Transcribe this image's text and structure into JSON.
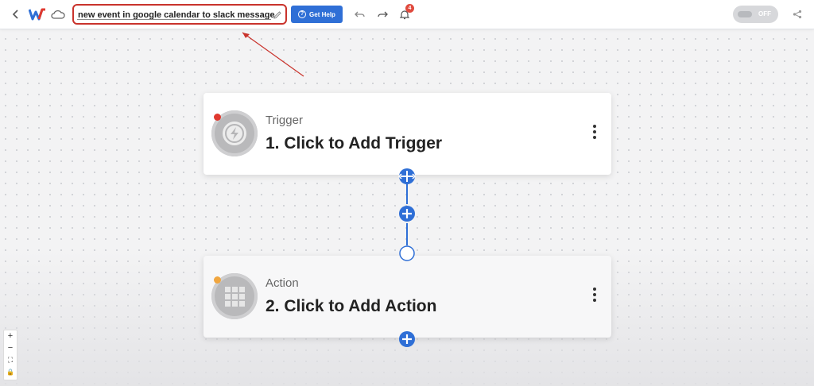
{
  "header": {
    "workflow_name": "new event in google calendar to slack message",
    "help_label": "Get Help",
    "help_icon": "question-circle-icon",
    "notification_count": "4",
    "toggle_label": "OFF"
  },
  "nodes": [
    {
      "type": "Trigger",
      "title": "1. Click to Add Trigger",
      "status_color": "#e0392f",
      "icon": "lightning-icon"
    },
    {
      "type": "Action",
      "title": "2. Click to Add Action",
      "status_color": "#f0a640",
      "icon": "grid-icon"
    }
  ],
  "zoom_controls": {
    "zoom_in": "+",
    "zoom_out": "−",
    "fit": "⛶",
    "lock": "🔒"
  },
  "colors": {
    "accent": "#2f6fd6",
    "annotation": "#c9332c"
  }
}
